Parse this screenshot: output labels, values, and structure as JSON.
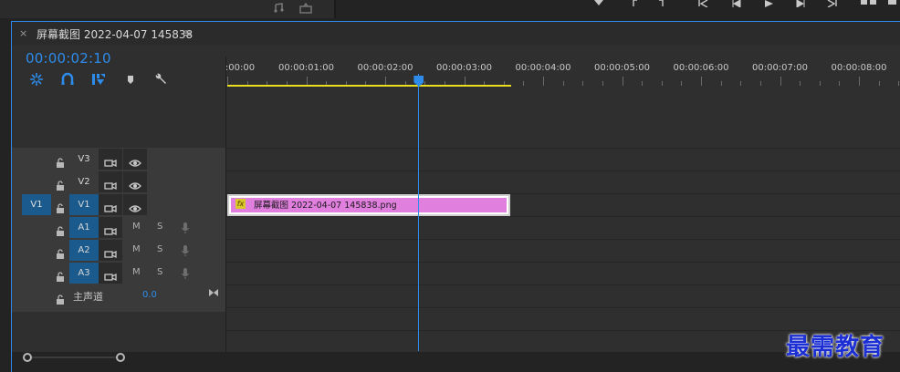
{
  "top_panel": {
    "icons": [
      "audio-note-icon",
      "export-frame-icon",
      "marker-icon",
      "in-point-icon",
      "out-point-icon",
      "go-to-in-icon",
      "step-back-icon",
      "play-icon",
      "step-forward-icon",
      "go-to-out-icon",
      "insert-icon",
      "lift-icon"
    ]
  },
  "tab": {
    "close_label": "×",
    "title": "屏幕截图 2022-04-07 145838",
    "menu_label": "≡"
  },
  "timecode": "00:00:02:10",
  "toolbar": {
    "icons": [
      "snap-icon",
      "linked-selection-icon",
      "add-marker-icon",
      "marker-icon",
      "wrench-icon"
    ]
  },
  "ruler": {
    "labels": [
      ":00:00",
      "00:00:01:00",
      "00:00:02:00",
      "00:00:03:00",
      "00:00:04:00",
      "00:00:05:00",
      "00:00:06:00",
      "00:00:07:00",
      "00:00:08:00"
    ],
    "playhead_seconds": 2.42,
    "work_area_end_seconds": 3.6
  },
  "tracks": {
    "video": [
      {
        "name": "V3",
        "source_target": "",
        "targeted": false
      },
      {
        "name": "V2",
        "source_target": "",
        "targeted": false
      },
      {
        "name": "V1",
        "source_target": "V1",
        "targeted": true
      }
    ],
    "audio": [
      {
        "name": "A1",
        "mute": "M",
        "solo": "S",
        "targeted": true
      },
      {
        "name": "A2",
        "mute": "M",
        "solo": "S",
        "targeted": true
      },
      {
        "name": "A3",
        "mute": "M",
        "solo": "S",
        "targeted": true
      }
    ],
    "master": {
      "name": "主声道",
      "volume": "0.0"
    }
  },
  "clip": {
    "fx_label": "fx",
    "name": "屏幕截图 2022-04-07  145838.png",
    "color": "#e17fdf",
    "start_seconds": 0,
    "end_seconds": 3.6
  },
  "watermark": "最需教育",
  "colors": {
    "accent": "#2d8ceb",
    "work_area": "#e6de1e",
    "target_blue": "#1b5a8c",
    "clip_pink": "#e17fdf"
  }
}
